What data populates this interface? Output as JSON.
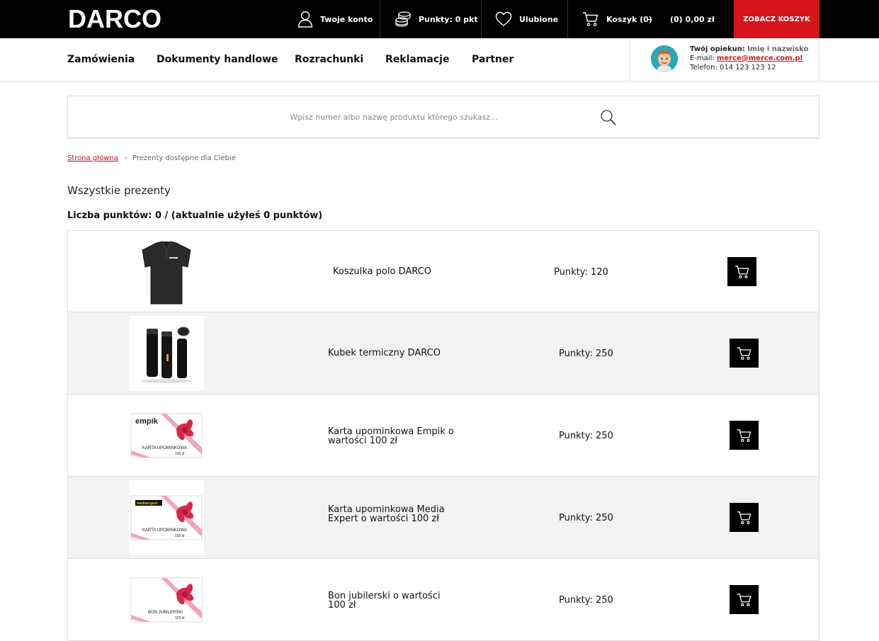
{
  "header": {
    "logo": "DARCO",
    "account": "Twoje konto",
    "points": "Punkty: 0 pkt",
    "favorites": "Ulubione",
    "cart": "Koszyk (0)",
    "cart_dash": "-",
    "cart_total": "(0) 0,00 zł",
    "see_cart": "ZOBACZ KOSZYK"
  },
  "nav": {
    "items": [
      "Zamówienia",
      "Dokumenty handlowe",
      "Rozrachunki",
      "Reklamacje",
      "Partner"
    ]
  },
  "advisor": {
    "label": "Twój opiekun:",
    "name": "Imię i nazwisko",
    "email_label": "E-mail:",
    "email": "merce@merce.com.pl",
    "phone": "Telefon: 014 123 123 12"
  },
  "search": {
    "placeholder": "Wpisz numer albo nazwę produktu którego szukasz..."
  },
  "breadcrumb": {
    "home": "Strona główna",
    "sep": "›",
    "current": "Prezenty dostępne dla Ciebie"
  },
  "page": {
    "title": "Wszystkie prezenty",
    "points_line": "Liczba punktów: 0 / (aktualnie użyłeś 0 punktów)"
  },
  "products": [
    {
      "name": "Koszulka polo DARCO",
      "points": "Punkty: 120",
      "image": "polo-shirt-image"
    },
    {
      "name": "Kubek termiczny DARCO",
      "points": "Punkty: 250",
      "image": "thermal-mug-image"
    },
    {
      "name": "Karta upominkowa Empik o wartości 100 zł",
      "points": "Punkty: 250",
      "image": "empik-card-image",
      "card_brand": "empik",
      "card_label": "KARTA UPOMINKOWA",
      "card_value": "100 zł"
    },
    {
      "name": "Karta upominkowa Media Expert o wartości 100 zł",
      "points": "Punkty: 250",
      "image": "mediaexpert-card-image",
      "card_brand": "mediaexpert",
      "card_label": "KARTA UPOMINKOWA",
      "card_value": "100 zł"
    },
    {
      "name": "Bon jubilerski o wartości 100 zł",
      "points": "Punkty: 250",
      "image": "jewelry-voucher-image",
      "card_label": "BON JUBILERSKI",
      "card_value": "100 zł"
    }
  ],
  "colors": {
    "accent": "#d8141d",
    "topbar": "#000000",
    "row_alt": "#f3f3f3"
  }
}
